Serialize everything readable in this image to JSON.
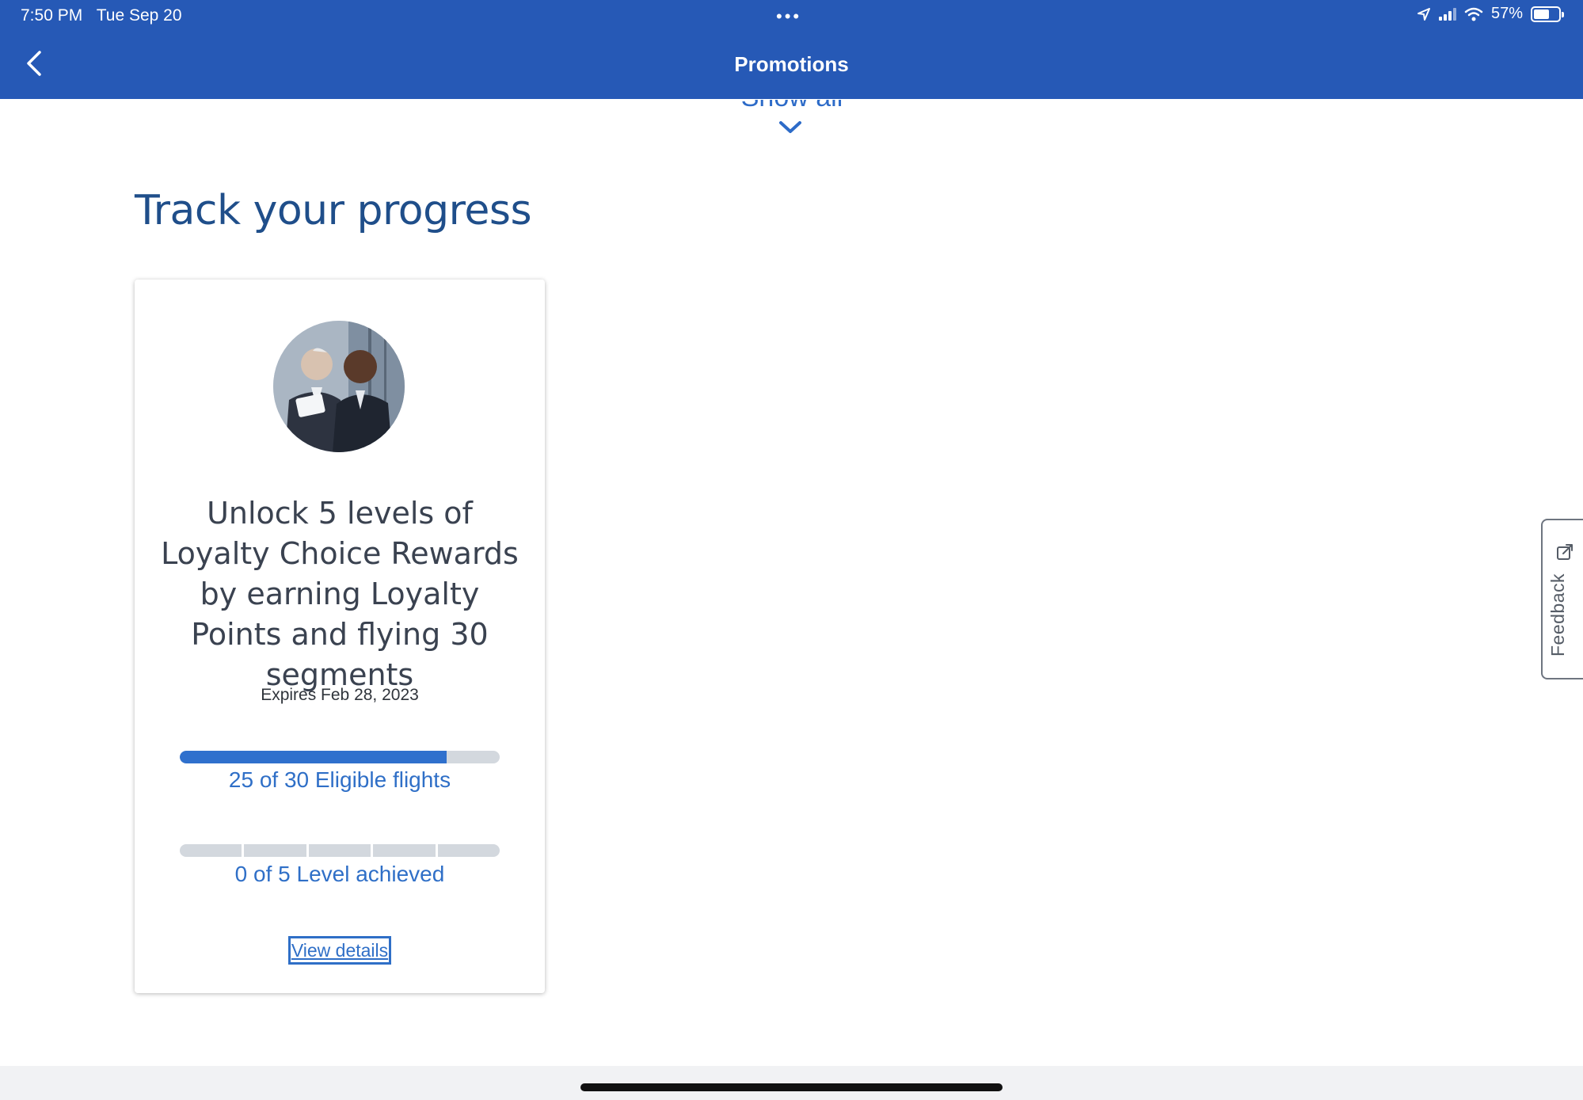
{
  "status_bar": {
    "time": "7:50 PM",
    "date": "Tue Sep 20",
    "dots": "•••",
    "battery": "57%",
    "icons": [
      "location-icon",
      "cellular-signal-icon",
      "wifi-icon",
      "battery-icon"
    ]
  },
  "nav": {
    "title": "Promotions",
    "back_icon": "chevron-left-icon"
  },
  "show_all": {
    "label": "Show all",
    "icon": "chevron-down-icon"
  },
  "section": {
    "title": "Track your progress"
  },
  "promo_card": {
    "image": "business-people-photo",
    "description": "Unlock 5 levels of Loyalty Choice Rewards by earning Loyalty Points and flying 30 segments",
    "expiry": "Expires Feb 28, 2023",
    "flights": {
      "current": 25,
      "total": 30,
      "label": "25 of 30 Eligible flights"
    },
    "levels": {
      "current": 0,
      "total": 5,
      "label": "0 of 5 Level achieved"
    },
    "view_details": "View details"
  },
  "feedback": {
    "label": "Feedback",
    "icon": "external-link-icon"
  },
  "colors": {
    "header": "#2659b6",
    "accent": "#2f70cd",
    "title": "#1f4e8a",
    "track": "#d3d8de"
  }
}
